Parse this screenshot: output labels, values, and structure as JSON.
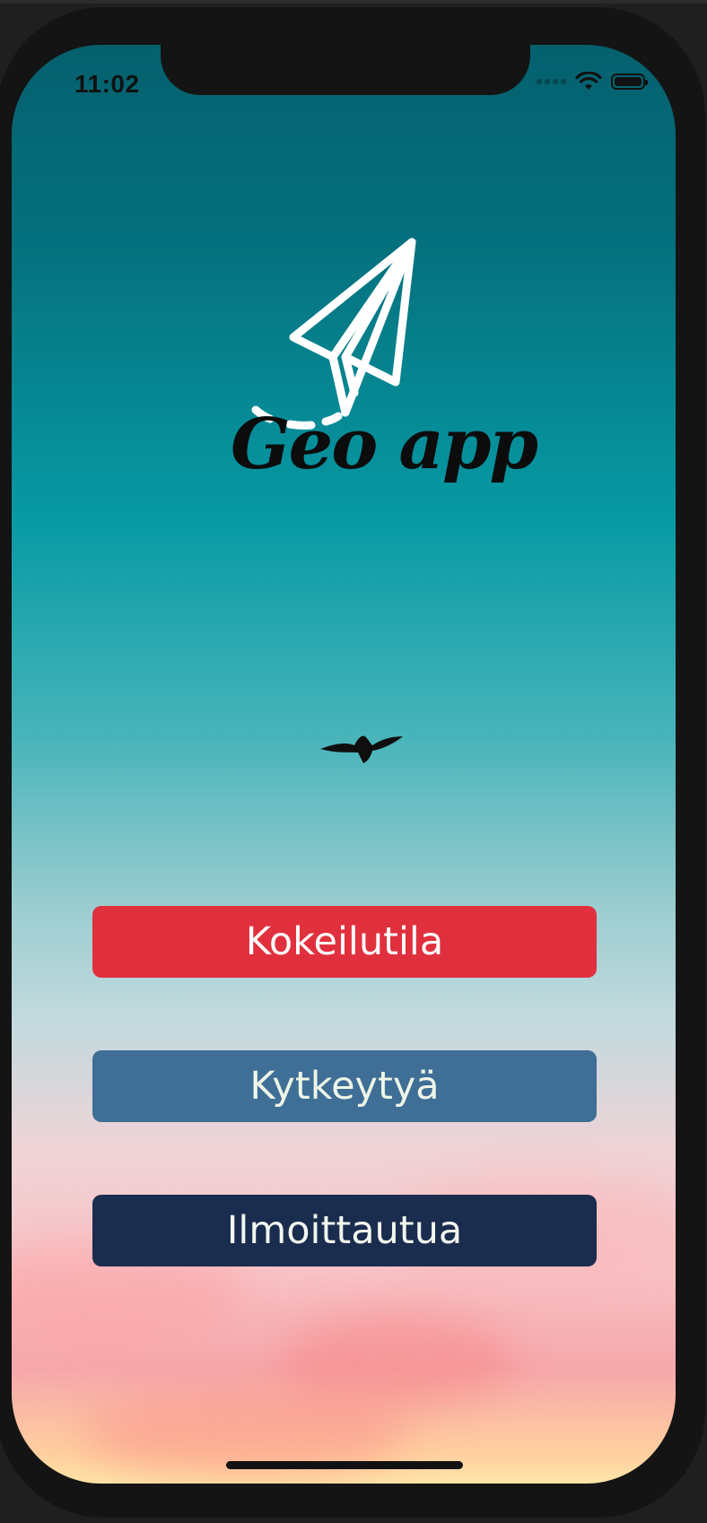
{
  "status_bar": {
    "time": "11:02",
    "icons": [
      "cellular-signal-icon",
      "wifi-icon",
      "battery-icon"
    ]
  },
  "logo": {
    "icon": "paper-plane-icon",
    "text": "Geo app"
  },
  "decoration": {
    "icon": "bird-icon"
  },
  "buttons": {
    "trial_label": "Kokeilutila",
    "connect_label": "Kytkeytyä",
    "signup_label": "Ilmoittautua"
  },
  "colors": {
    "trial": "#e1303d",
    "connect": "#3f6e96",
    "signup": "#1b2d4e"
  }
}
